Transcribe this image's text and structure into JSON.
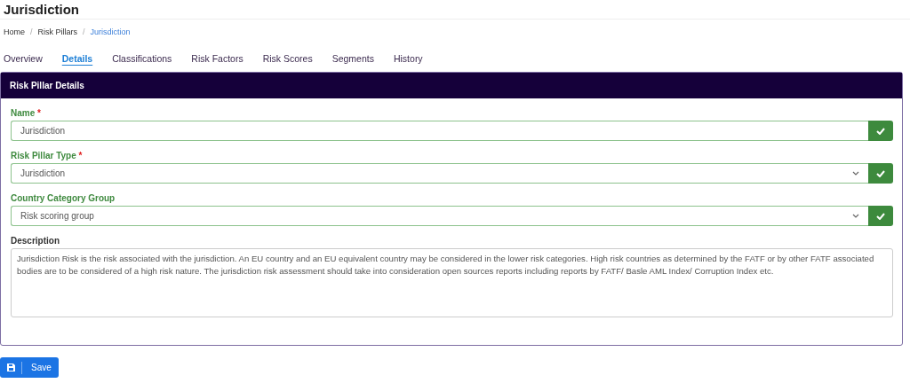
{
  "page_title": "Jurisdiction",
  "breadcrumb": [
    {
      "label": "Home",
      "current": false
    },
    {
      "separator": "/",
      "label": "Risk Pillars",
      "current": false
    },
    {
      "separator": "/",
      "label": "Jurisdiction",
      "current": true
    }
  ],
  "tabs": [
    {
      "label": "Overview",
      "selected": false
    },
    {
      "label": "Details",
      "selected": true
    },
    {
      "label": "Classifications",
      "selected": false
    },
    {
      "label": "Risk Factors",
      "selected": false
    },
    {
      "label": "Risk Scores",
      "selected": false
    },
    {
      "label": "Segments",
      "selected": false
    },
    {
      "label": "History",
      "selected": false
    }
  ],
  "panel": {
    "title": "Risk Pillar Details",
    "fields": [
      {
        "kind": "text",
        "label": "Name",
        "required_mark": "*",
        "valid": true,
        "value": "Jurisdiction"
      },
      {
        "kind": "select",
        "label": "Risk Pillar Type",
        "required_mark": "*",
        "valid": true,
        "value": "Jurisdiction"
      },
      {
        "kind": "select",
        "label": "Country Category Group",
        "valid": true,
        "value": "Risk scoring group"
      },
      {
        "kind": "textarea",
        "label": "Description",
        "valid": false,
        "value": "Jurisdiction Risk is the risk associated with the jurisdiction. An EU country and an EU equivalent country may be considered in the lower risk categories. High risk countries as determined by the FATF or by other FATF associated bodies are to be considered of a high risk nature. The jurisdiction risk assessment should take into consideration open sources reports including reports by FATF/ Basle AML Index/ Corruption Index etc."
      }
    ]
  },
  "save_button": {
    "label": "Save"
  }
}
